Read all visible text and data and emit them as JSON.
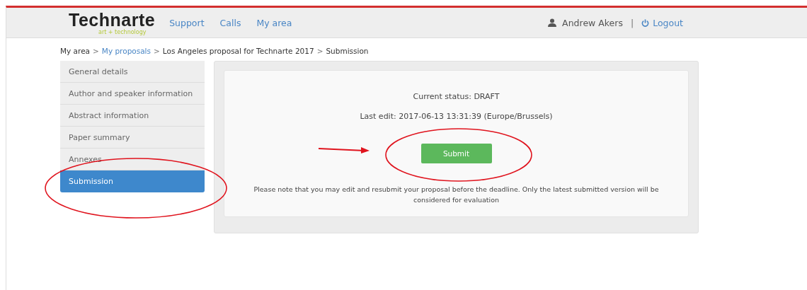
{
  "header": {
    "logo": "Technarte",
    "tagline": "art + technology",
    "nav": [
      "Support",
      "Calls",
      "My area"
    ],
    "user": "Andrew Akers",
    "divider": "|",
    "logout": "Logout"
  },
  "breadcrumb": {
    "separator": ">",
    "items": [
      {
        "label": "My area",
        "link": false
      },
      {
        "label": "My proposals",
        "link": true
      },
      {
        "label": "Los Angeles proposal for Technarte 2017",
        "link": false
      },
      {
        "label": "Submission",
        "link": false
      }
    ]
  },
  "sidebar": {
    "items": [
      {
        "label": "General details",
        "selected": false
      },
      {
        "label": "Author and speaker information",
        "selected": false
      },
      {
        "label": "Abstract information",
        "selected": false
      },
      {
        "label": "Paper summary",
        "selected": false
      },
      {
        "label": "Annexes",
        "selected": false
      },
      {
        "label": "Submission",
        "selected": true
      }
    ]
  },
  "panel": {
    "status": "Current status: DRAFT",
    "last_edit": "Last edit: 2017-06-13 13:31:39 (Europe/Brussels)",
    "button": "Submit",
    "note": "Please note that you may edit and resubmit your proposal before the deadline. Only the latest submitted version will be considered for evaluation"
  },
  "annotations": [
    {
      "kind": "ellipse"
    },
    {
      "kind": "ellipse"
    },
    {
      "kind": "arrow"
    }
  ]
}
